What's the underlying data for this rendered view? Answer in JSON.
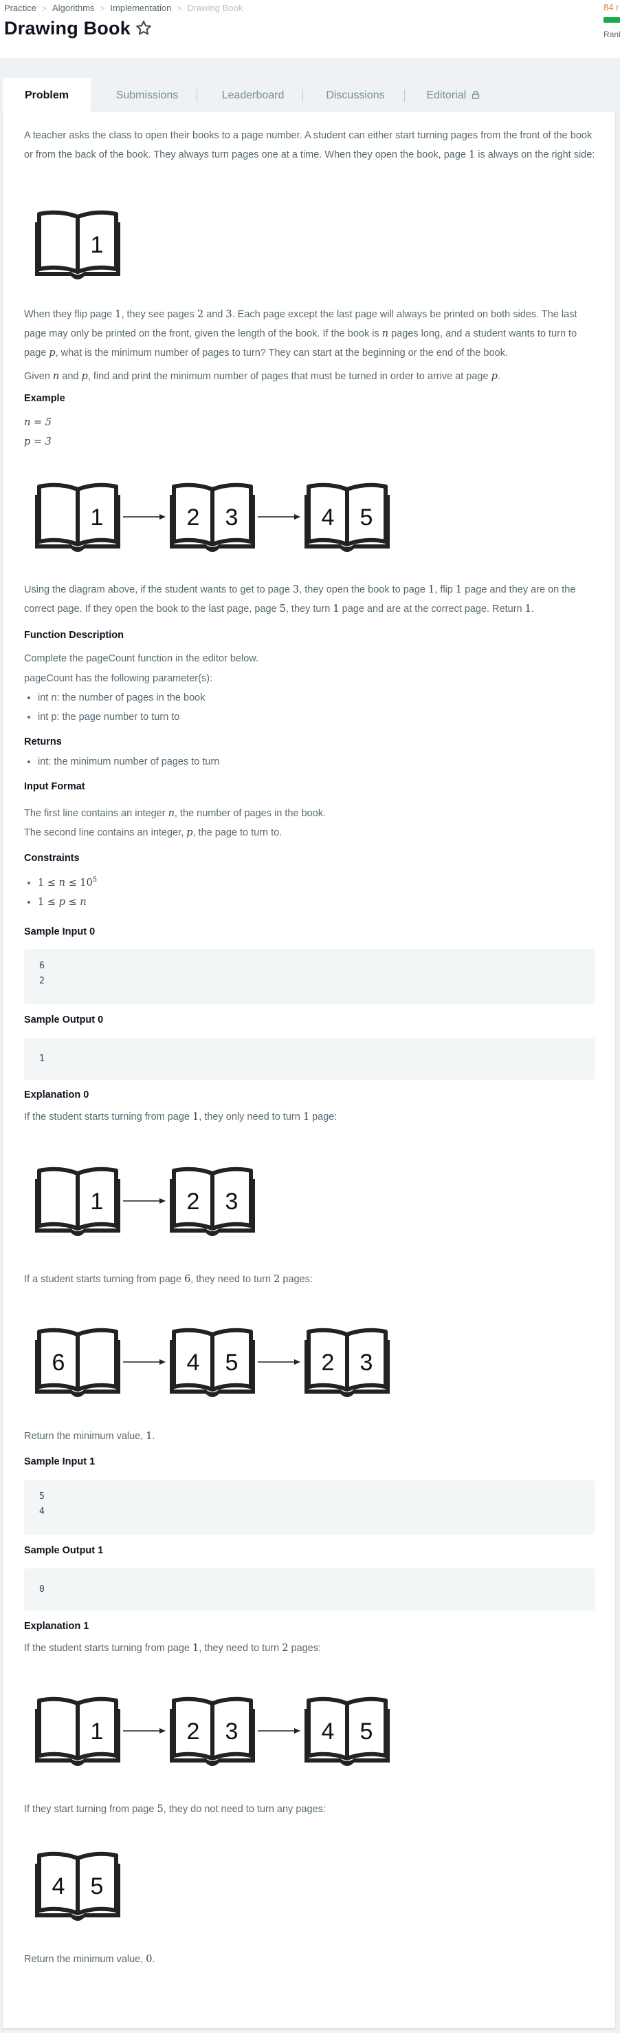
{
  "breadcrumb": [
    "Practice",
    "Algorithms",
    "Implementation",
    "Drawing Book"
  ],
  "title": "Drawing Book",
  "score_text": "84 r",
  "rank_text": "Rank",
  "tabs": [
    "Problem",
    "Submissions",
    "Leaderboard",
    "Discussions",
    "Editorial"
  ],
  "intro": {
    "a": "A teacher asks the class to open their books to a page number. A student can either start turning pages from the front of the book or from the back of the book. They always turn pages one at a time. When they open the book, page ",
    "b": "1",
    "c": " is always on the right side:"
  },
  "para2": {
    "a": "When they flip page ",
    "b": "1",
    "c": ", they see pages ",
    "d": "2",
    "e": " and ",
    "f": "3",
    "g": ". Each page except the last page will always be printed on both sides. The last page may only be printed on the front, given the length of the book. If the book is ",
    "h": "n",
    "i": " pages long, and a student wants to turn to page ",
    "j": "p",
    "k": ", what is the minimum number of pages to turn? They can start at the beginning or the end of the book."
  },
  "para3": {
    "a": "Given ",
    "b": "n",
    "c": " and ",
    "d": "p",
    "e": ", find and print the minimum number of pages that must be turned in order to arrive at page ",
    "f": "p",
    "g": "."
  },
  "example_heading": "Example",
  "example_n": "n = 5",
  "example_p": "p = 3",
  "para4": {
    "a": "Using the diagram above, if the student wants to get to page ",
    "b": "3",
    "c": ", they open the book to page ",
    "d": "1",
    "e": ", flip ",
    "f": "1",
    "g": " page and they are on the correct page. If they open the book to the last page, page ",
    "h": "5",
    "i": ", they turn ",
    "j": "1",
    "k": " page and are at the correct page. Return ",
    "l": "1",
    "m": "."
  },
  "function_heading": "Function Description",
  "function_text": "Complete the pageCount function in the editor below.",
  "params_text": "pageCount has the following parameter(s):",
  "params": [
    "int n: the number of pages in the book",
    "int p: the page number to turn to"
  ],
  "returns_heading": "Returns",
  "returns": [
    "int: the minimum number of pages to turn"
  ],
  "input_heading": "Input Format",
  "input1": {
    "a": "The first line contains an integer ",
    "b": "n",
    "c": ", the number of pages in the book."
  },
  "input2": {
    "a": "The second line contains an integer, ",
    "b": "p",
    "c": ", the page to turn to."
  },
  "constraints_heading": "Constraints",
  "constraint1": {
    "a": "1 ≤ ",
    "b": "n",
    "c": " ≤ 10",
    "d": "5"
  },
  "constraint2": {
    "a": "1 ≤ ",
    "b": "p",
    "c": " ≤ ",
    "d": "n"
  },
  "sample_input0_heading": "Sample Input 0",
  "sample_input0": [
    "6",
    "2"
  ],
  "sample_output0_heading": "Sample Output 0",
  "sample_output0": [
    "1"
  ],
  "explanation0_heading": "Explanation 0",
  "exp0a": {
    "a": "If the student starts turning from page ",
    "b": "1",
    "c": ", they only need to turn ",
    "d": "1",
    "e": " page:"
  },
  "exp0b": {
    "a": "If a student starts turning from page ",
    "b": "6",
    "c": ", they need to turn ",
    "d": "2",
    "e": " pages:"
  },
  "exp0c": {
    "a": "Return the minimum value, ",
    "b": "1",
    "c": "."
  },
  "sample_input1_heading": "Sample Input 1",
  "sample_input1": [
    "5",
    "4"
  ],
  "sample_output1_heading": "Sample Output 1",
  "sample_output1": [
    "0"
  ],
  "explanation1_heading": "Explanation 1",
  "exp1a": {
    "a": "If the student starts turning from page ",
    "b": "1",
    "c": ", they need to turn ",
    "d": "2",
    "e": " pages:"
  },
  "exp1b": {
    "a": "If they start turning from page ",
    "b": "5",
    "c": ", they do not need to turn any pages:"
  },
  "exp1c": {
    "a": "Return the minimum value, ",
    "b": "0",
    "c": "."
  },
  "diagrams": {
    "intro": [
      [
        "",
        "1"
      ]
    ],
    "example": [
      [
        "",
        "1"
      ],
      [
        "2",
        "3"
      ],
      [
        "4",
        "5"
      ]
    ],
    "exp0a": [
      [
        "",
        "1"
      ],
      [
        "2",
        "3"
      ]
    ],
    "exp0b": [
      [
        "6",
        ""
      ],
      [
        "4",
        "5"
      ],
      [
        "2",
        "3"
      ]
    ],
    "exp1a": [
      [
        "",
        "1"
      ],
      [
        "2",
        "3"
      ],
      [
        "4",
        "5"
      ]
    ],
    "exp1b": [
      [
        "4",
        "5"
      ]
    ]
  },
  "colors": {
    "accent_orange": "#e3833d",
    "progress_green": "#1ba94c",
    "text": "#576871",
    "heading": "#0e141e"
  }
}
